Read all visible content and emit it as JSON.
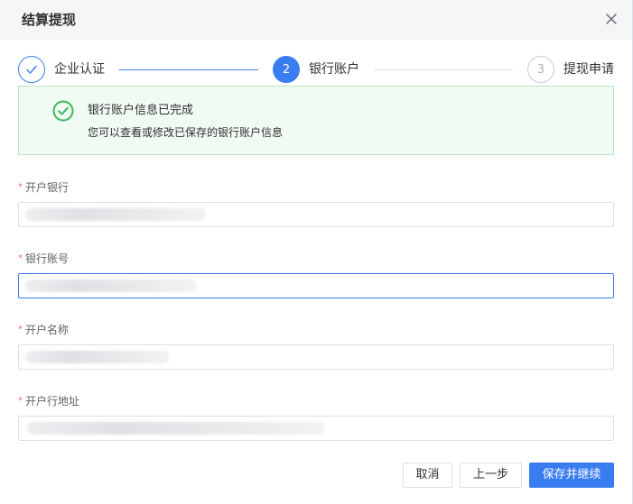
{
  "dialog": {
    "title": "结算提现",
    "close_icon": "close-icon"
  },
  "steps": [
    {
      "number": "1",
      "label": "企业认证",
      "status": "done",
      "icon": "check-icon"
    },
    {
      "number": "2",
      "label": "银行账户",
      "status": "active"
    },
    {
      "number": "3",
      "label": "提现申请",
      "status": "pending"
    }
  ],
  "banner": {
    "icon": "check-circle-icon",
    "title": "银行账户信息已完成",
    "description": "您可以查看或修改已保存的银行账户信息"
  },
  "form": {
    "required_mark": "*",
    "fields": [
      {
        "label": "开户银行",
        "value": "",
        "focused": false
      },
      {
        "label": "银行账号",
        "value": "",
        "focused": true
      },
      {
        "label": "开户名称",
        "value": "",
        "focused": false
      },
      {
        "label": "开户行地址",
        "value": "",
        "focused": false
      }
    ]
  },
  "footer": {
    "cancel_label": "取消",
    "prev_label": "上一步",
    "save_label": "保存并继续"
  },
  "colors": {
    "primary": "#3a7df0",
    "success": "#3fb65f",
    "success_bg": "#f0fbf3",
    "required": "#f56c6c"
  }
}
